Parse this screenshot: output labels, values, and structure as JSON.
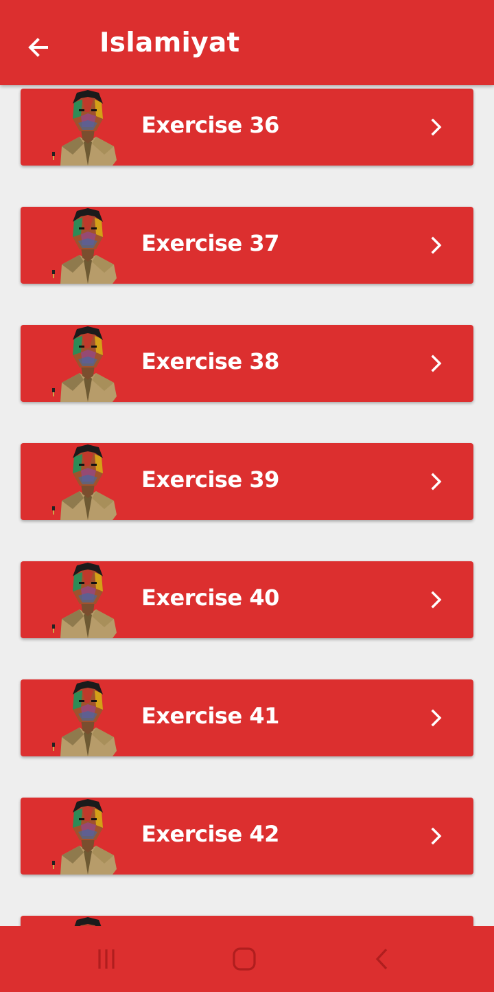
{
  "appbar": {
    "title": "Islamiyat",
    "back_icon": "arrow-left-icon"
  },
  "colors": {
    "primary": "#dc2f2f",
    "background": "#eeeeee",
    "text_on_primary": "#ffffff"
  },
  "exercises": [
    {
      "label": "Exercise 36"
    },
    {
      "label": "Exercise 37"
    },
    {
      "label": "Exercise 38"
    },
    {
      "label": "Exercise 39"
    },
    {
      "label": "Exercise 40"
    },
    {
      "label": "Exercise 41"
    },
    {
      "label": "Exercise 42"
    },
    {
      "label": ""
    }
  ],
  "item_icons": {
    "avatar": "portrait-avatar-icon",
    "chevron": "chevron-right-icon"
  },
  "navbar": {
    "recents_icon": "recents-icon",
    "home_icon": "home-icon",
    "back_icon": "back-icon"
  }
}
